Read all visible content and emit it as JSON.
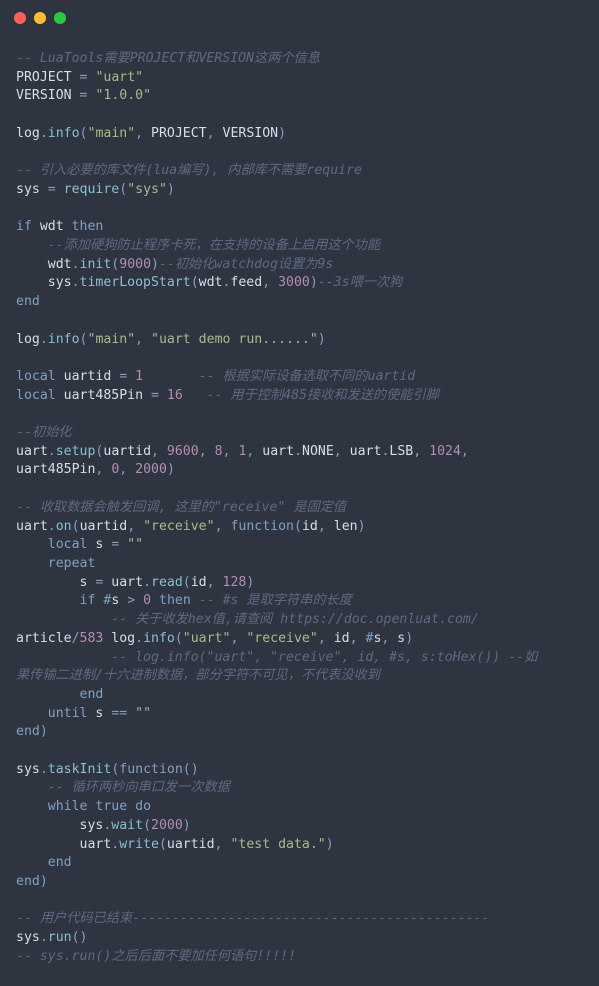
{
  "titlebar": {
    "buttons": [
      "close",
      "minimize",
      "maximize"
    ]
  },
  "code": {
    "lines": [
      [
        [
          "comment",
          "-- LuaTools需要PROJECT和VERSION这两个信息"
        ]
      ],
      [
        [
          "ident",
          "PROJECT "
        ],
        [
          "op",
          "="
        ],
        [
          "ident",
          " "
        ],
        [
          "string",
          "\"uart\""
        ]
      ],
      [
        [
          "ident",
          "VERSION "
        ],
        [
          "op",
          "="
        ],
        [
          "ident",
          " "
        ],
        [
          "string",
          "\"1.0.0\""
        ]
      ],
      [
        [
          "ident",
          ""
        ]
      ],
      [
        [
          "ident",
          "log"
        ],
        [
          "op",
          "."
        ],
        [
          "func",
          "info"
        ],
        [
          "op",
          "("
        ],
        [
          "string",
          "\"main\""
        ],
        [
          "op",
          ","
        ],
        [
          "ident",
          " PROJECT"
        ],
        [
          "op",
          ","
        ],
        [
          "ident",
          " VERSION"
        ],
        [
          "op",
          ")"
        ]
      ],
      [
        [
          "ident",
          ""
        ]
      ],
      [
        [
          "comment",
          "-- 引入必要的库文件(lua编写), 内部库不需要require"
        ]
      ],
      [
        [
          "ident",
          "sys "
        ],
        [
          "op",
          "="
        ],
        [
          "ident",
          " "
        ],
        [
          "func",
          "require"
        ],
        [
          "op",
          "("
        ],
        [
          "string",
          "\"sys\""
        ],
        [
          "op",
          ")"
        ]
      ],
      [
        [
          "ident",
          ""
        ]
      ],
      [
        [
          "keyword",
          "if"
        ],
        [
          "ident",
          " wdt "
        ],
        [
          "keyword",
          "then"
        ]
      ],
      [
        [
          "ident",
          "    "
        ],
        [
          "comment",
          "--添加硬狗防止程序卡死，在支持的设备上启用这个功能"
        ]
      ],
      [
        [
          "ident",
          "    wdt"
        ],
        [
          "op",
          "."
        ],
        [
          "func",
          "init"
        ],
        [
          "op",
          "("
        ],
        [
          "number",
          "9000"
        ],
        [
          "op",
          ")"
        ],
        [
          "comment",
          "--初始化watchdog设置为9s"
        ]
      ],
      [
        [
          "ident",
          "    sys"
        ],
        [
          "op",
          "."
        ],
        [
          "func",
          "timerLoopStart"
        ],
        [
          "op",
          "("
        ],
        [
          "ident",
          "wdt"
        ],
        [
          "op",
          "."
        ],
        [
          "ident",
          "feed"
        ],
        [
          "op",
          ","
        ],
        [
          "ident",
          " "
        ],
        [
          "number",
          "3000"
        ],
        [
          "op",
          ")"
        ],
        [
          "comment",
          "--3s喂一次狗"
        ]
      ],
      [
        [
          "keyword",
          "end"
        ]
      ],
      [
        [
          "ident",
          ""
        ]
      ],
      [
        [
          "ident",
          "log"
        ],
        [
          "op",
          "."
        ],
        [
          "func",
          "info"
        ],
        [
          "op",
          "("
        ],
        [
          "string",
          "\"main\""
        ],
        [
          "op",
          ","
        ],
        [
          "ident",
          " "
        ],
        [
          "string",
          "\"uart demo run......\""
        ],
        [
          "op",
          ")"
        ]
      ],
      [
        [
          "ident",
          ""
        ]
      ],
      [
        [
          "keyword",
          "local"
        ],
        [
          "ident",
          " uartid "
        ],
        [
          "op",
          "="
        ],
        [
          "ident",
          " "
        ],
        [
          "number",
          "1"
        ],
        [
          "ident",
          "       "
        ],
        [
          "comment",
          "-- 根据实际设备选取不同的uartid"
        ]
      ],
      [
        [
          "keyword",
          "local"
        ],
        [
          "ident",
          " uart485Pin "
        ],
        [
          "op",
          "="
        ],
        [
          "ident",
          " "
        ],
        [
          "number",
          "16"
        ],
        [
          "ident",
          "   "
        ],
        [
          "comment",
          "-- 用于控制485接收和发送的使能引脚"
        ]
      ],
      [
        [
          "ident",
          ""
        ]
      ],
      [
        [
          "comment",
          "--初始化"
        ]
      ],
      [
        [
          "ident",
          "uart"
        ],
        [
          "op",
          "."
        ],
        [
          "func",
          "setup"
        ],
        [
          "op",
          "("
        ],
        [
          "ident",
          "uartid"
        ],
        [
          "op",
          ","
        ],
        [
          "ident",
          " "
        ],
        [
          "number",
          "9600"
        ],
        [
          "op",
          ","
        ],
        [
          "ident",
          " "
        ],
        [
          "number",
          "8"
        ],
        [
          "op",
          ","
        ],
        [
          "ident",
          " "
        ],
        [
          "number",
          "1"
        ],
        [
          "op",
          ","
        ],
        [
          "ident",
          " uart"
        ],
        [
          "op",
          "."
        ],
        [
          "ident",
          "NONE"
        ],
        [
          "op",
          ","
        ],
        [
          "ident",
          " uart"
        ],
        [
          "op",
          "."
        ],
        [
          "ident",
          "LSB"
        ],
        [
          "op",
          ","
        ],
        [
          "ident",
          " "
        ],
        [
          "number",
          "1024"
        ],
        [
          "op",
          ","
        ],
        [
          "ident",
          " "
        ]
      ],
      [
        [
          "ident",
          "uart485Pin"
        ],
        [
          "op",
          ","
        ],
        [
          "ident",
          " "
        ],
        [
          "number",
          "0"
        ],
        [
          "op",
          ","
        ],
        [
          "ident",
          " "
        ],
        [
          "number",
          "2000"
        ],
        [
          "op",
          ")"
        ]
      ],
      [
        [
          "ident",
          ""
        ]
      ],
      [
        [
          "comment",
          "-- 收取数据会触发回调, 这里的\"receive\" 是固定值"
        ]
      ],
      [
        [
          "ident",
          "uart"
        ],
        [
          "op",
          "."
        ],
        [
          "func",
          "on"
        ],
        [
          "op",
          "("
        ],
        [
          "ident",
          "uartid"
        ],
        [
          "op",
          ","
        ],
        [
          "ident",
          " "
        ],
        [
          "string",
          "\"receive\""
        ],
        [
          "op",
          ","
        ],
        [
          "ident",
          " "
        ],
        [
          "keyword",
          "function"
        ],
        [
          "op",
          "("
        ],
        [
          "ident",
          "id"
        ],
        [
          "op",
          ","
        ],
        [
          "ident",
          " len"
        ],
        [
          "op",
          ")"
        ]
      ],
      [
        [
          "ident",
          "    "
        ],
        [
          "keyword",
          "local"
        ],
        [
          "ident",
          " s "
        ],
        [
          "op",
          "="
        ],
        [
          "ident",
          " "
        ],
        [
          "string",
          "\"\""
        ]
      ],
      [
        [
          "ident",
          "    "
        ],
        [
          "keyword",
          "repeat"
        ]
      ],
      [
        [
          "ident",
          "        s "
        ],
        [
          "op",
          "="
        ],
        [
          "ident",
          " uart"
        ],
        [
          "op",
          "."
        ],
        [
          "func",
          "read"
        ],
        [
          "op",
          "("
        ],
        [
          "ident",
          "id"
        ],
        [
          "op",
          ","
        ],
        [
          "ident",
          " "
        ],
        [
          "number",
          "128"
        ],
        [
          "op",
          ")"
        ]
      ],
      [
        [
          "ident",
          "        "
        ],
        [
          "keyword",
          "if"
        ],
        [
          "ident",
          " "
        ],
        [
          "op",
          "#"
        ],
        [
          "ident",
          "s "
        ],
        [
          "op",
          ">"
        ],
        [
          "ident",
          " "
        ],
        [
          "number",
          "0"
        ],
        [
          "ident",
          " "
        ],
        [
          "keyword",
          "then"
        ],
        [
          "ident",
          " "
        ],
        [
          "comment",
          "-- #s 是取字符串的长度"
        ]
      ],
      [
        [
          "ident",
          "            "
        ],
        [
          "comment",
          "-- 关于收发hex值,请查阅 https://doc.openluat.com/"
        ]
      ],
      [
        [
          "ident",
          "article"
        ],
        [
          "op",
          "/"
        ],
        [
          "number",
          "583"
        ],
        [
          "ident",
          " log"
        ],
        [
          "op",
          "."
        ],
        [
          "func",
          "info"
        ],
        [
          "op",
          "("
        ],
        [
          "string",
          "\"uart\""
        ],
        [
          "op",
          ","
        ],
        [
          "ident",
          " "
        ],
        [
          "string",
          "\"receive\""
        ],
        [
          "op",
          ","
        ],
        [
          "ident",
          " id"
        ],
        [
          "op",
          ","
        ],
        [
          "ident",
          " "
        ],
        [
          "op",
          "#"
        ],
        [
          "ident",
          "s"
        ],
        [
          "op",
          ","
        ],
        [
          "ident",
          " s"
        ],
        [
          "op",
          ")"
        ]
      ],
      [
        [
          "ident",
          "            "
        ],
        [
          "comment",
          "-- log.info(\"uart\", \"receive\", id, #s, s:toHex()) --如"
        ]
      ],
      [
        [
          "comment",
          "果传输二进制/十六进制数据，部分字符不可见，不代表没收到"
        ]
      ],
      [
        [
          "ident",
          "        "
        ],
        [
          "keyword",
          "end"
        ]
      ],
      [
        [
          "ident",
          "    "
        ],
        [
          "keyword",
          "until"
        ],
        [
          "ident",
          " s "
        ],
        [
          "op",
          "=="
        ],
        [
          "ident",
          " "
        ],
        [
          "string",
          "\"\""
        ]
      ],
      [
        [
          "keyword",
          "end"
        ],
        [
          "op",
          ")"
        ]
      ],
      [
        [
          "ident",
          ""
        ]
      ],
      [
        [
          "ident",
          "sys"
        ],
        [
          "op",
          "."
        ],
        [
          "func",
          "taskInit"
        ],
        [
          "op",
          "("
        ],
        [
          "keyword",
          "function"
        ],
        [
          "op",
          "()"
        ]
      ],
      [
        [
          "ident",
          "    "
        ],
        [
          "comment",
          "-- 循环两秒向串口发一次数据"
        ]
      ],
      [
        [
          "ident",
          "    "
        ],
        [
          "keyword",
          "while"
        ],
        [
          "ident",
          " "
        ],
        [
          "const",
          "true"
        ],
        [
          "ident",
          " "
        ],
        [
          "keyword",
          "do"
        ]
      ],
      [
        [
          "ident",
          "        sys"
        ],
        [
          "op",
          "."
        ],
        [
          "func",
          "wait"
        ],
        [
          "op",
          "("
        ],
        [
          "number",
          "2000"
        ],
        [
          "op",
          ")"
        ]
      ],
      [
        [
          "ident",
          "        uart"
        ],
        [
          "op",
          "."
        ],
        [
          "func",
          "write"
        ],
        [
          "op",
          "("
        ],
        [
          "ident",
          "uartid"
        ],
        [
          "op",
          ","
        ],
        [
          "ident",
          " "
        ],
        [
          "string",
          "\"test data.\""
        ],
        [
          "op",
          ")"
        ]
      ],
      [
        [
          "ident",
          "    "
        ],
        [
          "keyword",
          "end"
        ]
      ],
      [
        [
          "keyword",
          "end"
        ],
        [
          "op",
          ")"
        ]
      ],
      [
        [
          "ident",
          ""
        ]
      ],
      [
        [
          "comment",
          "-- 用户代码已结束---------------------------------------------"
        ]
      ],
      [
        [
          "ident",
          "sys"
        ],
        [
          "op",
          "."
        ],
        [
          "func",
          "run"
        ],
        [
          "op",
          "()"
        ]
      ],
      [
        [
          "comment",
          "-- sys.run()之后后面不要加任何语句!!!!!"
        ]
      ]
    ]
  }
}
